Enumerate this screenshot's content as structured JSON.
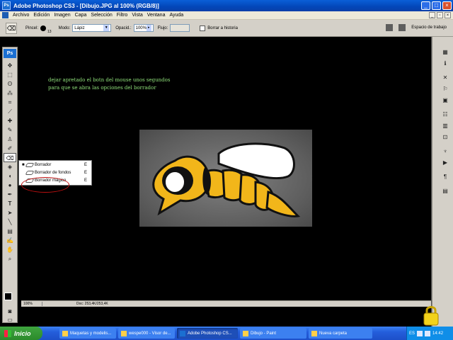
{
  "window": {
    "title": "Adobe Photoshop CS3 - [Dibujo.JPG al 100% (RGB/8)]",
    "app_icon": "Ps"
  },
  "menu": {
    "items": [
      "Archivo",
      "Edición",
      "Imagen",
      "Capa",
      "Selección",
      "Filtro",
      "Vista",
      "Ventana",
      "Ayuda"
    ]
  },
  "options": {
    "brush_label": "Pincel:",
    "brush_size": "13",
    "mode_label": "Modo:",
    "mode_value": "Lápiz",
    "opacity_label": "Opacid.:",
    "opacity_value": "100%",
    "flow_label": "Flujo:",
    "erase_history_label": "Borrar a historia",
    "workspace_label": "Espacio de trabajo"
  },
  "toolbox": {
    "logo": "Ps"
  },
  "canvas": {
    "instructions": "dejar apretado el botn del mouse unos segundos para que se abra las opciones del borrador"
  },
  "context_menu": {
    "items": [
      {
        "label": "Borrador",
        "shortcut": "E",
        "selected": true
      },
      {
        "label": "Borrador de fondos",
        "shortcut": "E",
        "selected": false
      },
      {
        "label": "Borrador mágico",
        "shortcut": "E",
        "selected": false
      }
    ]
  },
  "status": {
    "zoom": "100%",
    "doc": "Doc: 253,4K/253,4K"
  },
  "taskbar": {
    "start": "Inicio",
    "tasks": [
      {
        "label": "Maquetas y modelis...",
        "active": false
      },
      {
        "label": "wespe000 - Visor de...",
        "active": false
      },
      {
        "label": "Adobe Photoshop CS...",
        "active": true
      },
      {
        "label": "Dibujo - Paint",
        "active": false
      },
      {
        "label": "Nueva carpeta",
        "active": false
      }
    ],
    "tray_lang": "ES",
    "clock": "14:42"
  },
  "colors": {
    "title_bar": "#0346b8",
    "instructions_text": "#8fe07a",
    "highlight_ellipse": "#c01010",
    "wasp_yellow": "#f2b61a"
  }
}
